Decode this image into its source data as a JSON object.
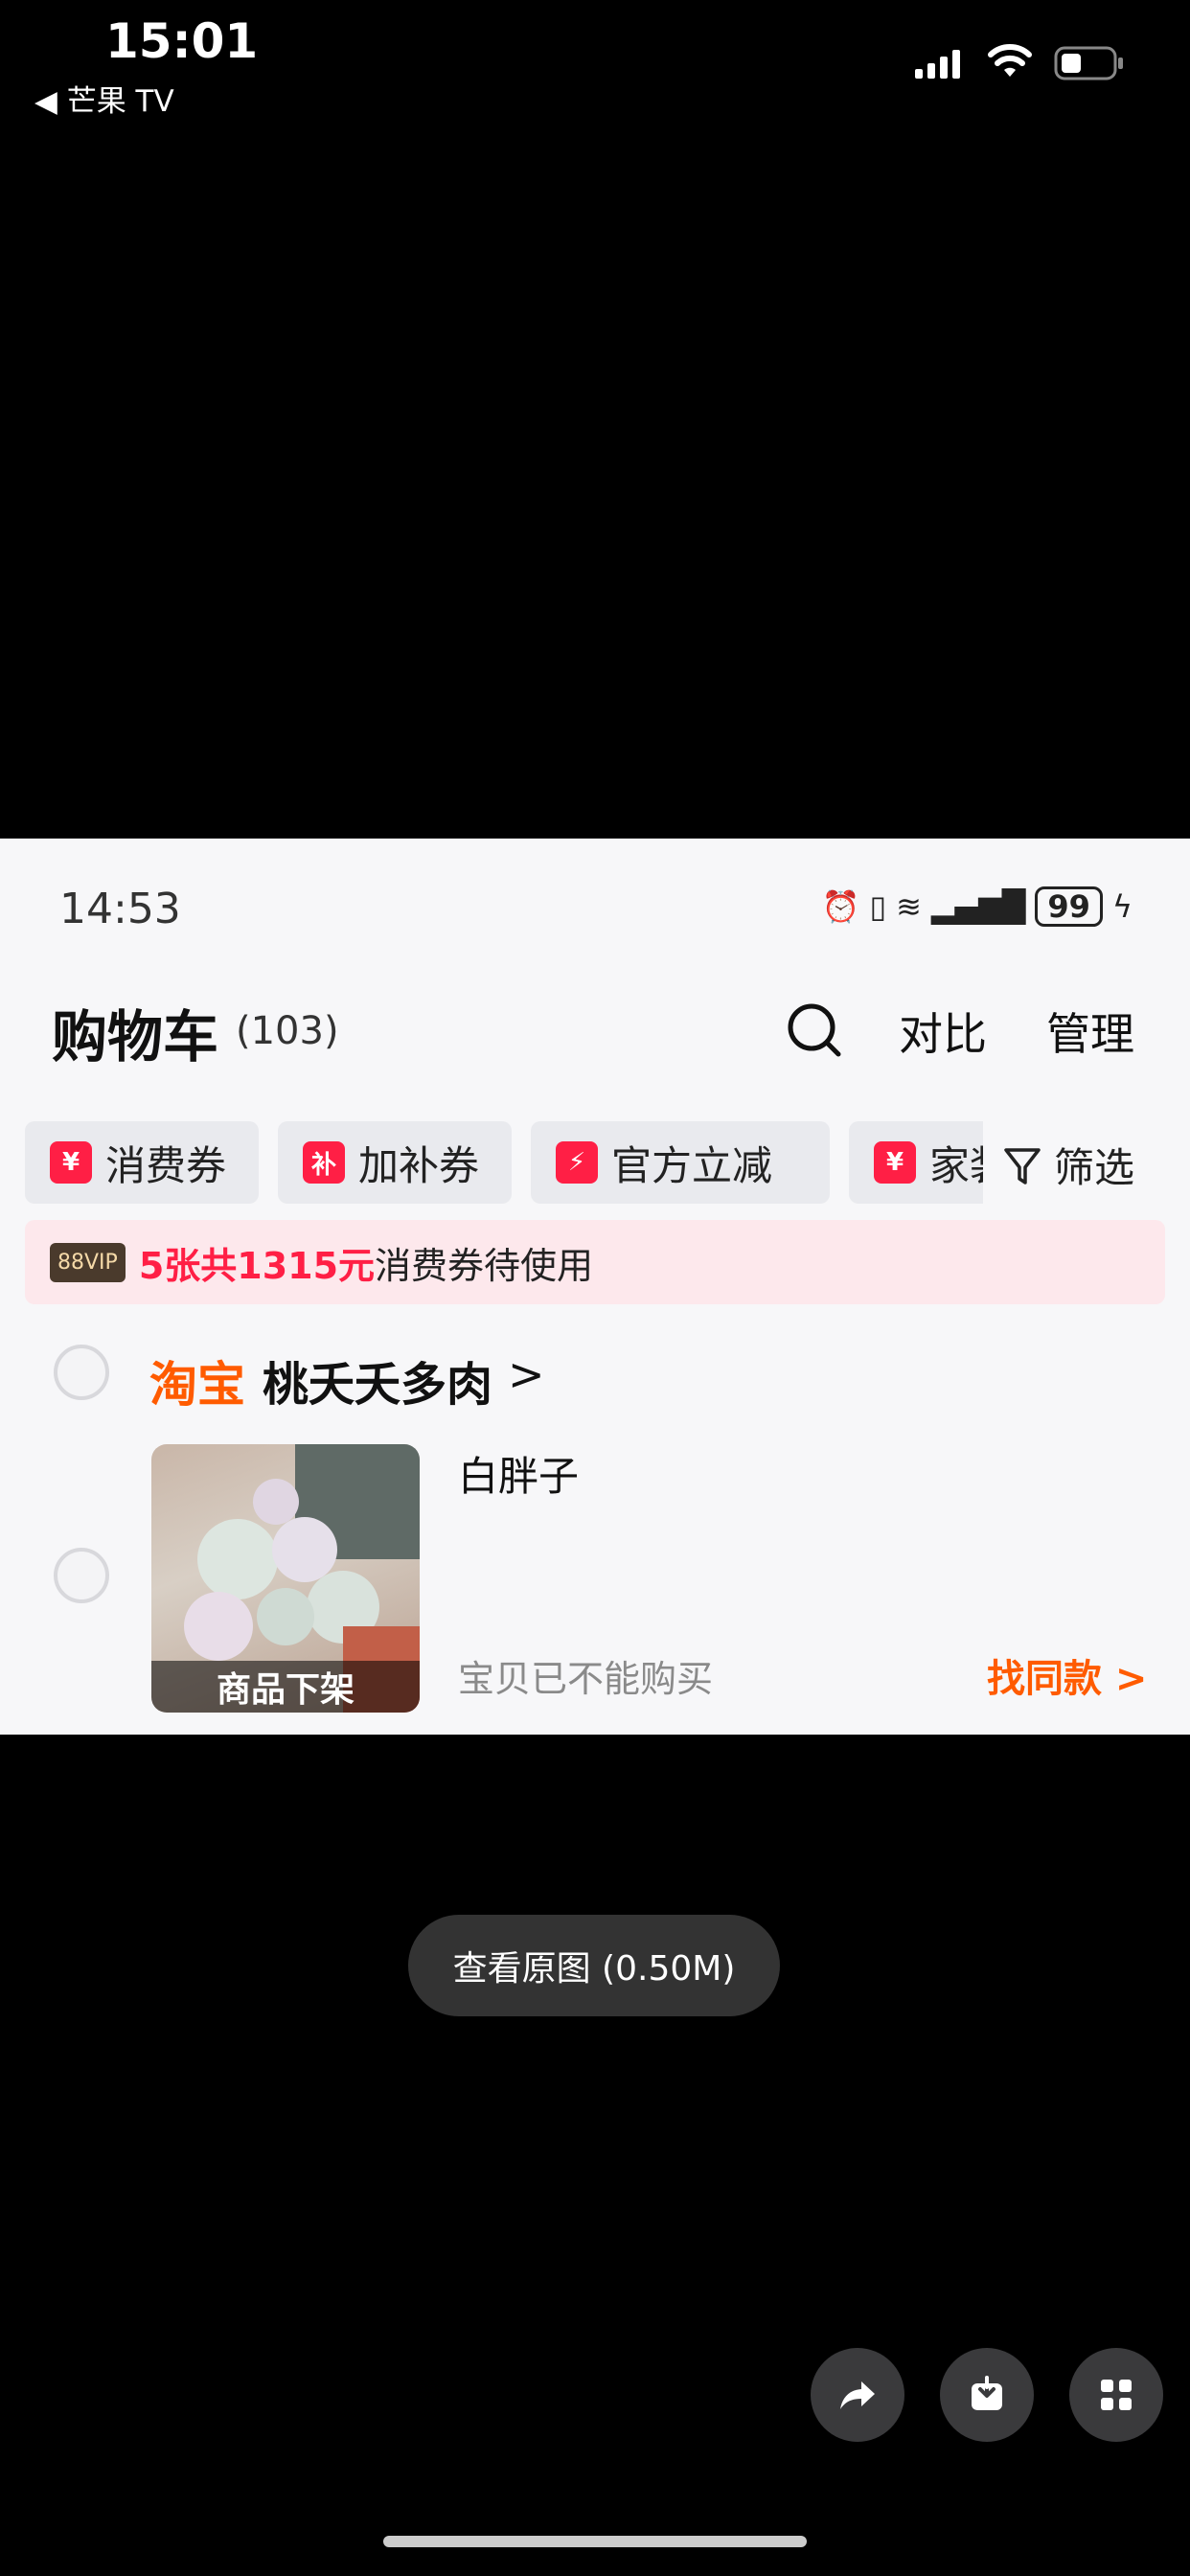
{
  "ios_status": {
    "time": "15:01",
    "back_label": "◀ 芒果 TV"
  },
  "shot": {
    "status": {
      "time": "14:53",
      "battery": "99"
    },
    "header": {
      "title": "购物车",
      "count": "(103)",
      "compare_label": "对比",
      "manage_label": "管理"
    },
    "chips": [
      {
        "icon": "¥",
        "label": "消费券"
      },
      {
        "icon": "补",
        "label": "加补券"
      },
      {
        "icon": "⚡",
        "label": "官方立减"
      },
      {
        "icon": "¥",
        "label": "家装"
      }
    ],
    "filter_label": "筛选",
    "banner": {
      "vip": "88VIP",
      "highlight": "5张共1315元",
      "rest": "消费券待使用"
    },
    "store": {
      "platform": "淘宝",
      "name": "桃夭夭多肉",
      "chevron": ">"
    },
    "item": {
      "name": "白胖子",
      "status": "宝贝已不能购买",
      "image_badge": "商品下架",
      "find_same": "找同款 >"
    }
  },
  "viewer": {
    "view_original": "查看原图 (0.50M)",
    "actions": [
      "share-icon",
      "download-icon",
      "grid-icon"
    ]
  },
  "colors": {
    "accent_red": "#ff1f45",
    "accent_orange": "#ff5b00"
  }
}
